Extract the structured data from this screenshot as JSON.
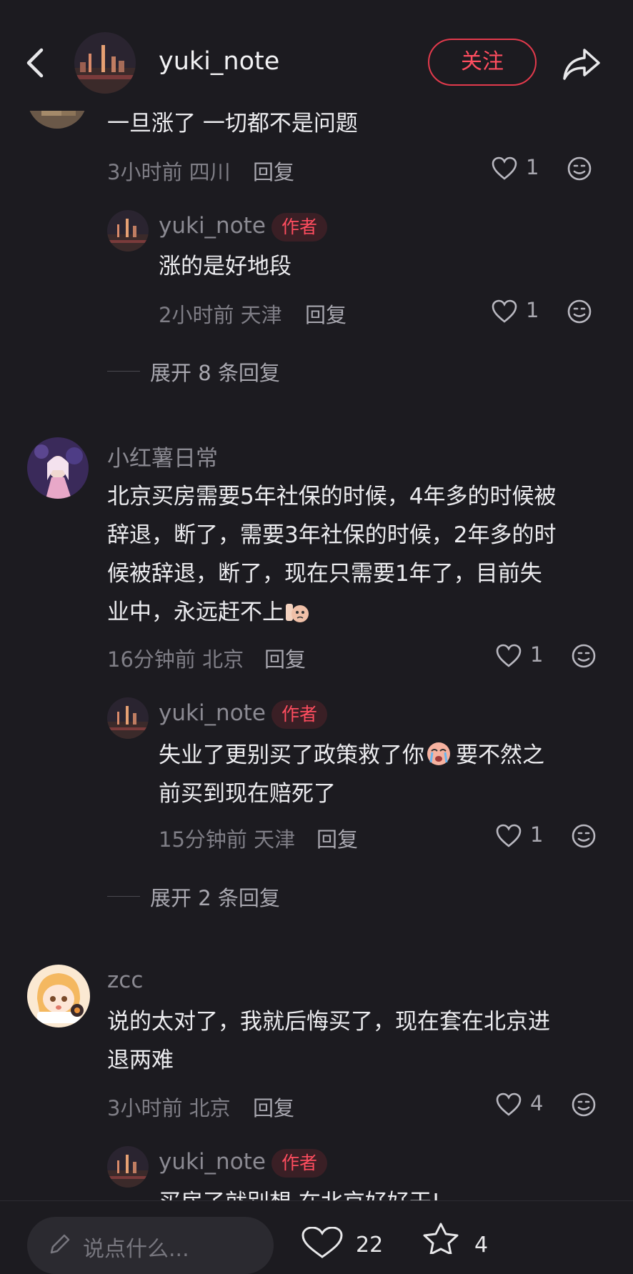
{
  "header": {
    "title": "yuki_note",
    "follow_label": "关注"
  },
  "comments": [
    {
      "text": "一旦涨了 一切都不是问题",
      "time": "3小时前 四川",
      "reply_label": "回复",
      "likes": "1",
      "replies": [
        {
          "name": "yuki_note",
          "badge": "作者",
          "text": "涨的是好地段",
          "time": "2小时前 天津",
          "reply_label": "回复",
          "likes": "1"
        }
      ],
      "expand_label": "展开 8 条回复"
    },
    {
      "name": "小红薯日常",
      "text_lines": [
        "北京买房需要5年社保的时候，4年多的时候被",
        "辞退，断了，需要3年社保的时候，2年多的时",
        "候被辞退，断了，现在只需要1年了，目前失",
        "业中，永远赶不上"
      ],
      "time": "16分钟前 北京",
      "reply_label": "回复",
      "likes": "1",
      "replies": [
        {
          "name": "yuki_note",
          "badge": "作者",
          "text_line1_a": "失业了更别买了政策救了你",
          "text_line1_b": "要不然之",
          "text_line2": "前买到现在赔死了",
          "time": "15分钟前 天津",
          "reply_label": "回复",
          "likes": "1"
        }
      ],
      "expand_label": "展开 2 条回复"
    },
    {
      "name": "zcc",
      "text_lines": [
        "说的太对了，我就后悔买了，现在套在北京进",
        "退两难"
      ],
      "time": "3小时前 北京",
      "reply_label": "回复",
      "likes": "4",
      "replies": [
        {
          "name": "yuki_note",
          "badge": "作者",
          "text": "买房了就别想 在北京好好干!"
        }
      ]
    }
  ],
  "bottom_bar": {
    "input_placeholder": "说点什么...",
    "like_count": "22",
    "star_count": "4"
  },
  "colors": {
    "background": "#1c1b20",
    "accent": "#ff4d5f"
  }
}
